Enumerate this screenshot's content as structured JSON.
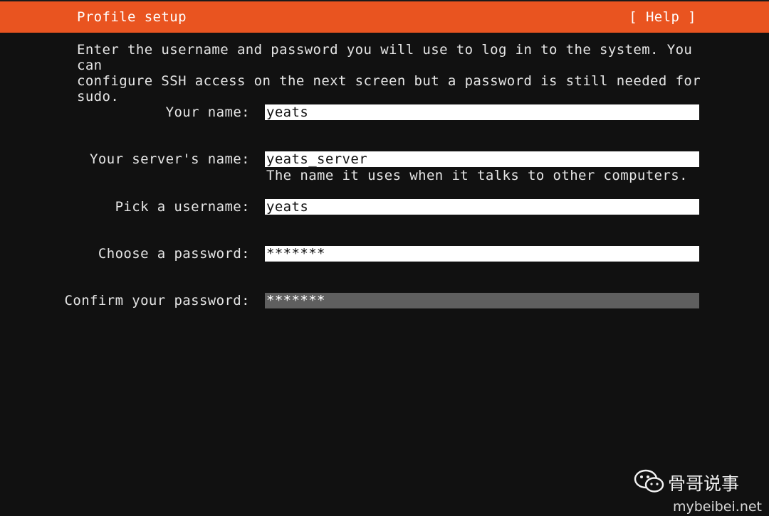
{
  "header": {
    "title": "Profile setup",
    "help_label": "[ Help ]",
    "accent_color": "#E95420"
  },
  "intro": {
    "text": "Enter the username and password you will use to log in to the system. You can\nconfigure SSH access on the next screen but a password is still needed for\nsudo."
  },
  "form": {
    "your_name": {
      "label": "Your name:",
      "value": "yeats"
    },
    "server_name": {
      "label": "Your server's name:",
      "value": "yeats_server",
      "hint": "The name it uses when it talks to other computers."
    },
    "username": {
      "label": "Pick a username:",
      "value": "yeats"
    },
    "password": {
      "label": "Choose a password:",
      "value": "*******"
    },
    "confirm_password": {
      "label": "Confirm your password:",
      "value": "*******"
    }
  },
  "watermark": {
    "logo_icon": "wechat-icon",
    "name": "骨哥说事",
    "url": "mybeibei.net"
  }
}
